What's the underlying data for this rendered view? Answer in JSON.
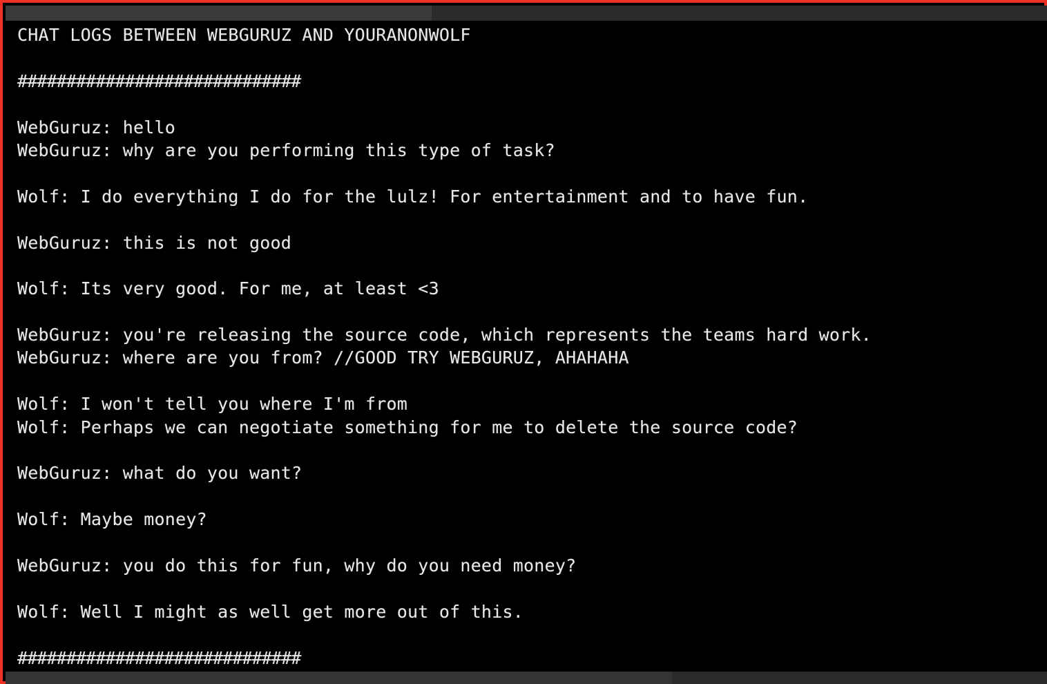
{
  "window": {
    "border_color": "#ef3124",
    "background_color": "#000000",
    "text_color": "#e8e8e8",
    "top_strip_color": "#2d2d2d",
    "bottom_strip_color": "#2f2f2f"
  },
  "console": {
    "title_line": "CHAT LOGS BETWEEN WEBGURUZ AND YOURANONWOLF",
    "separator": "#############################",
    "blank": " ",
    "lines": [
      {
        "id": "title",
        "text": "CHAT LOGS BETWEEN WEBGURUZ AND YOURANONWOLF",
        "kind": "title"
      },
      {
        "id": "blank-1",
        "text": " ",
        "kind": "blank"
      },
      {
        "id": "sep-top",
        "text": "#############################",
        "kind": "separator"
      },
      {
        "id": "blank-2",
        "text": " ",
        "kind": "blank"
      },
      {
        "id": "msg-1",
        "text": "WebGuruz: hello",
        "kind": "message",
        "speaker": "WebGuruz"
      },
      {
        "id": "msg-2",
        "text": "WebGuruz: why are you performing this type of task?",
        "kind": "message",
        "speaker": "WebGuruz"
      },
      {
        "id": "blank-3",
        "text": " ",
        "kind": "blank"
      },
      {
        "id": "msg-3",
        "text": "Wolf: I do everything I do for the lulz! For entertainment and to have fun.",
        "kind": "message",
        "speaker": "Wolf"
      },
      {
        "id": "blank-4",
        "text": " ",
        "kind": "blank"
      },
      {
        "id": "msg-4",
        "text": "WebGuruz: this is not good",
        "kind": "message",
        "speaker": "WebGuruz"
      },
      {
        "id": "blank-5",
        "text": " ",
        "kind": "blank"
      },
      {
        "id": "msg-5",
        "text": "Wolf: Its very good. For me, at least <3",
        "kind": "message",
        "speaker": "Wolf"
      },
      {
        "id": "blank-6",
        "text": " ",
        "kind": "blank"
      },
      {
        "id": "msg-6",
        "text": "WebGuruz: you're releasing the source code, which represents the teams hard work.",
        "kind": "message",
        "speaker": "WebGuruz"
      },
      {
        "id": "msg-7",
        "text": "WebGuruz: where are you from? //GOOD TRY WEBGURUZ, AHAHAHA",
        "kind": "message",
        "speaker": "WebGuruz"
      },
      {
        "id": "blank-7",
        "text": " ",
        "kind": "blank"
      },
      {
        "id": "msg-8",
        "text": "Wolf: I won't tell you where I'm from",
        "kind": "message",
        "speaker": "Wolf"
      },
      {
        "id": "msg-9",
        "text": "Wolf: Perhaps we can negotiate something for me to delete the source code?",
        "kind": "message",
        "speaker": "Wolf"
      },
      {
        "id": "blank-8",
        "text": " ",
        "kind": "blank"
      },
      {
        "id": "msg-10",
        "text": "WebGuruz: what do you want?",
        "kind": "message",
        "speaker": "WebGuruz"
      },
      {
        "id": "blank-9",
        "text": " ",
        "kind": "blank"
      },
      {
        "id": "msg-11",
        "text": "Wolf: Maybe money?",
        "kind": "message",
        "speaker": "Wolf"
      },
      {
        "id": "blank-10",
        "text": " ",
        "kind": "blank"
      },
      {
        "id": "msg-12",
        "text": "WebGuruz: you do this for fun, why do you need money?",
        "kind": "message",
        "speaker": "WebGuruz"
      },
      {
        "id": "blank-11",
        "text": " ",
        "kind": "blank"
      },
      {
        "id": "msg-13",
        "text": "Wolf: Well I might as well get more out of this.",
        "kind": "message",
        "speaker": "Wolf"
      },
      {
        "id": "blank-12",
        "text": " ",
        "kind": "blank"
      },
      {
        "id": "sep-bottom",
        "text": "#############################",
        "kind": "separator"
      }
    ]
  }
}
